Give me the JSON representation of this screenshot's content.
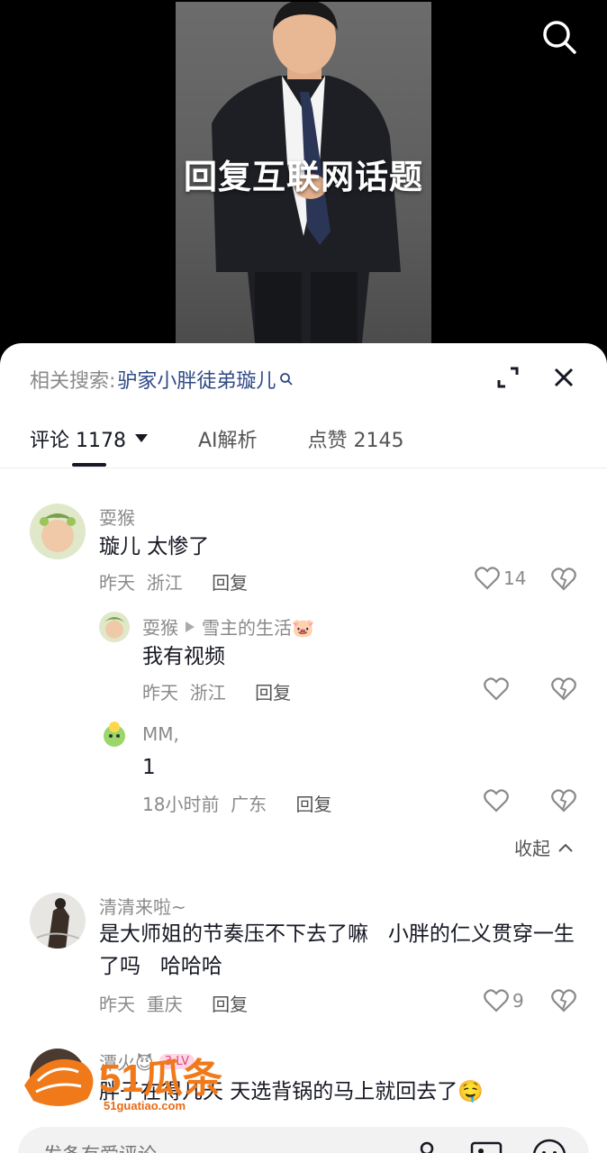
{
  "video": {
    "caption": "回复互联网话题",
    "search_icon": "search-icon"
  },
  "sheet": {
    "related_prefix": "相关搜索:",
    "related_term": "驴家小胖徒弟璇儿",
    "tabs": [
      {
        "label": "评论 1178"
      },
      {
        "label": "AI解析"
      },
      {
        "label": "点赞 2145"
      }
    ]
  },
  "comments": [
    {
      "user": "耍猴",
      "text": "璇儿 太惨了",
      "time": "昨天",
      "region": "浙江",
      "reply": "回复",
      "likes": "14"
    },
    {
      "user": "耍猴",
      "reply_to": "雪主的生活🐷",
      "text": "我有视频",
      "time": "昨天",
      "region": "浙江",
      "reply": "回复",
      "likes": ""
    },
    {
      "user": "MM,",
      "text": "1",
      "time": "18小时前",
      "region": "广东",
      "reply": "回复",
      "likes": ""
    },
    {
      "user": "清清来啦~",
      "text": "是大师姐的节奏压不下去了嘛   小胖的仁义贯穿一生了吗   哈哈哈",
      "time": "昨天",
      "region": "重庆",
      "reply": "回复",
      "likes": "9"
    },
    {
      "user": "潭火😈",
      "badge": "3 LV",
      "text": "胖子在得几天 天选背锅的马上就回去了🤤"
    }
  ],
  "collapse_label": "收起",
  "input": {
    "placeholder": "发条有爱评论"
  },
  "watermark": {
    "brand": "51瓜条",
    "url": "51guatiao.com"
  },
  "colors": {
    "related_term": "#2f4a86",
    "heart": "#8a8a8a",
    "watermark": "#f07a1a"
  }
}
